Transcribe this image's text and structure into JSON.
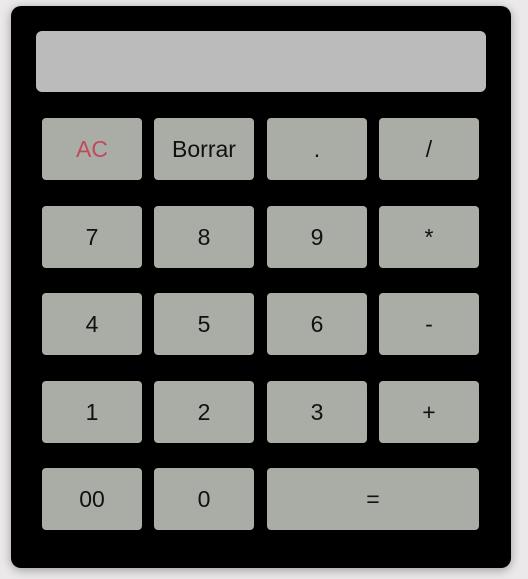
{
  "display": {
    "value": ""
  },
  "keys": {
    "clear": "AC",
    "delete": "Borrar",
    "decimal": ".",
    "divide": "/",
    "seven": "7",
    "eight": "8",
    "nine": "9",
    "multiply": "*",
    "four": "4",
    "five": "5",
    "six": "6",
    "subtract": "-",
    "one": "1",
    "two": "2",
    "three": "3",
    "add": "+",
    "double_zero": "00",
    "zero": "0",
    "equals": "="
  },
  "colors": {
    "body": "#000000",
    "display": "#bbbbbb",
    "key": "#aaada6",
    "clear_text": "#c04a5a"
  }
}
